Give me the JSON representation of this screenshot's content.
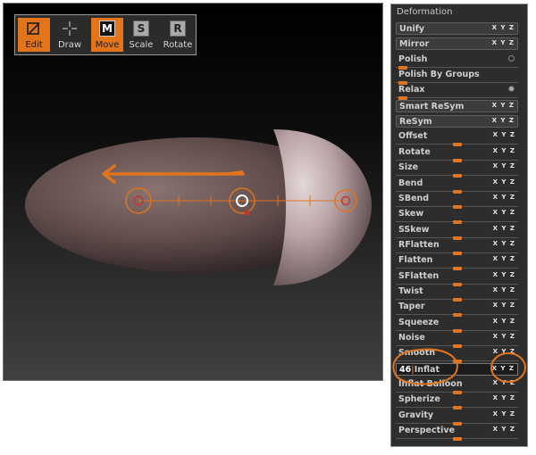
{
  "toolbar": {
    "tools": [
      {
        "label": "Edit",
        "icon": "edit-icon",
        "active": true
      },
      {
        "label": "Draw",
        "icon": "draw-icon",
        "active": false
      },
      {
        "label": "Move",
        "icon": "move-icon",
        "letter": "M",
        "active": true
      },
      {
        "label": "Scale",
        "icon": "scale-icon",
        "letter": "S",
        "active": false
      },
      {
        "label": "Rotate",
        "icon": "rotate-icon",
        "letter": "R",
        "active": false
      }
    ]
  },
  "panel": {
    "title": "Deformation",
    "axis": {
      "x": "X",
      "y": "Y",
      "z": "Z"
    },
    "items": [
      {
        "label": "Unify",
        "kind": "button"
      },
      {
        "label": "Mirror",
        "kind": "button"
      },
      {
        "label": "Polish",
        "kind": "slider",
        "value": 0.02
      },
      {
        "label": "Polish By Groups",
        "kind": "slider",
        "value": 0.02
      },
      {
        "label": "Relax",
        "kind": "slider",
        "value": 0.02
      },
      {
        "label": "Smart ReSym",
        "kind": "button"
      },
      {
        "label": "ReSym",
        "kind": "button"
      },
      {
        "label": "Offset",
        "kind": "slider",
        "value": 0.5
      },
      {
        "label": "Rotate",
        "kind": "slider",
        "value": 0.5
      },
      {
        "label": "Size",
        "kind": "slider",
        "value": 0.5
      },
      {
        "label": "Bend",
        "kind": "slider",
        "value": 0.5
      },
      {
        "label": "SBend",
        "kind": "slider",
        "value": 0.5
      },
      {
        "label": "Skew",
        "kind": "slider",
        "value": 0.5
      },
      {
        "label": "SSkew",
        "kind": "slider",
        "value": 0.5
      },
      {
        "label": "RFlatten",
        "kind": "slider",
        "value": 0.5
      },
      {
        "label": "Flatten",
        "kind": "slider",
        "value": 0.5
      },
      {
        "label": "SFlatten",
        "kind": "slider",
        "value": 0.5
      },
      {
        "label": "Twist",
        "kind": "slider",
        "value": 0.5
      },
      {
        "label": "Taper",
        "kind": "slider",
        "value": 0.5
      },
      {
        "label": "Squeeze",
        "kind": "slider",
        "value": 0.5
      },
      {
        "label": "Noise",
        "kind": "slider",
        "value": 0.5
      },
      {
        "label": "Smooth",
        "kind": "slider",
        "value": 0.5
      },
      {
        "label": "Inflat",
        "kind": "input",
        "value": "46"
      },
      {
        "label": "Inflat Balloon",
        "kind": "slider",
        "value": 0.5
      },
      {
        "label": "Spherize",
        "kind": "slider",
        "value": 0.5
      },
      {
        "label": "Gravity",
        "kind": "slider",
        "value": 0.5
      },
      {
        "label": "Perspective",
        "kind": "slider",
        "value": 0.5
      }
    ]
  },
  "colors": {
    "accent": "#e2741c",
    "panel_bg": "#2d2d2d",
    "annotation": "#e2741c"
  }
}
